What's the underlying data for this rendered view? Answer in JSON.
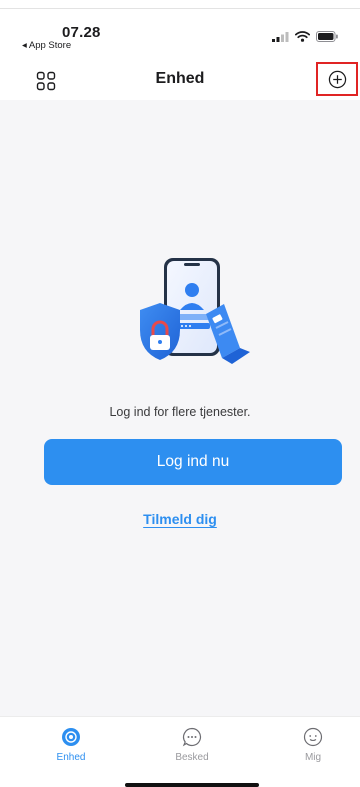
{
  "status_bar": {
    "time": "07.28",
    "back_app": "◂ App Store"
  },
  "header": {
    "title": "Enhed"
  },
  "main": {
    "prompt": "Log ind for flere tjenester.",
    "login_button": "Log ind nu",
    "signup_link": "Tilmeld dig"
  },
  "tabs": [
    {
      "label": "Enhed",
      "icon": "device-icon",
      "active": true
    },
    {
      "label": "Besked",
      "icon": "message-icon",
      "active": false
    },
    {
      "label": "Mig",
      "icon": "profile-icon",
      "active": false
    }
  ],
  "colors": {
    "accent": "#2d8ff0",
    "highlight_outline": "#e02424",
    "main_background": "#f6f6f8",
    "inactive_tab": "#9a9a9e"
  }
}
